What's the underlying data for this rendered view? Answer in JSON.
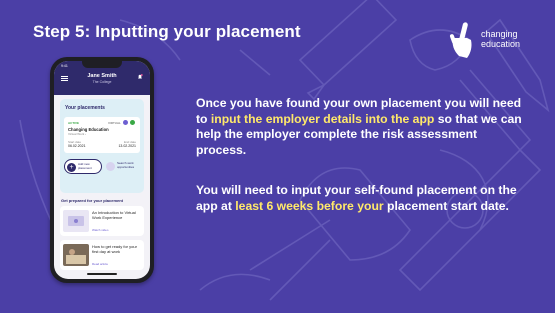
{
  "slide": {
    "title_step": "Step 5:",
    "title_rest": " Inputting your placement",
    "colors": {
      "background": "#4b3fa6",
      "text": "#ffffff",
      "highlight": "#ffe96a",
      "app_header": "#2f2a6b"
    }
  },
  "logo": {
    "line1": "changing",
    "line2": "education",
    "icon": "hand-icon"
  },
  "phone": {
    "status_time": "9:41",
    "header_name": "Jane Smith",
    "header_sub": "The College",
    "your_placements": "Your placements",
    "placement": {
      "status": "ACTIVE",
      "mode": "VIRTUAL",
      "organisation": "Changing Education",
      "organisation_sub": "Virtual Work ›",
      "start_label": "Start date",
      "start_date": "06.02.2021",
      "end_label": "End date",
      "end_date": "13.02.2021"
    },
    "add_button": "Add new placement",
    "search_button": "Search work opportunities",
    "get_prepared": "Get prepared for your placement",
    "resources": [
      {
        "title": "An Introduction to Virtual Work Experience",
        "link": "Watch video"
      },
      {
        "title": "How to get ready for your first day at work",
        "link": "Read article"
      }
    ]
  },
  "body": {
    "p1_a": "Once you have found your own placement you will need to ",
    "p1_hl": "input the employer details into the app",
    "p1_b": " so that we can help the employer complete the risk assessment process.",
    "p2_a": "You will need to input your self-found placement on the app at ",
    "p2_hl": "least 6 weeks before your",
    "p2_b": " placement start date."
  }
}
